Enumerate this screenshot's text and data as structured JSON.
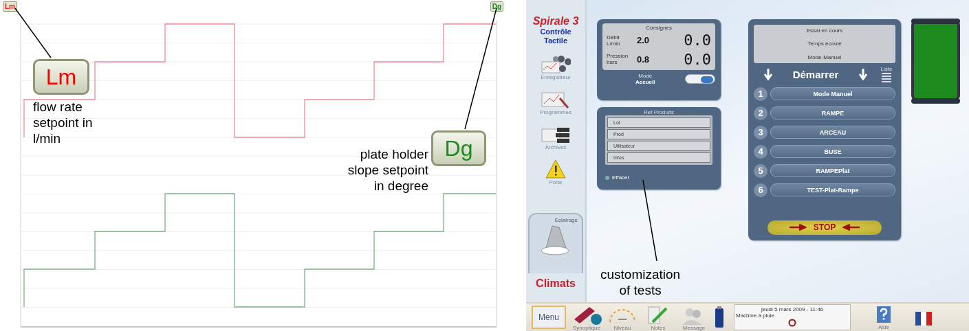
{
  "chart_panel": {
    "corner_tags": [
      {
        "text": "Lm",
        "color": "#e02020"
      },
      {
        "text": "Dg",
        "color": "#1a8a1a"
      }
    ],
    "annotations": [
      {
        "kind": "flow",
        "tag": "Lm",
        "color": "#ff0000",
        "lines": [
          "flow rate",
          "setpoint in",
          "l/min"
        ]
      },
      {
        "kind": "slope",
        "tag": "Dg",
        "color": "#1a8a1a",
        "lines": [
          "plate holder",
          "slope setpoint",
          "in degree"
        ]
      }
    ]
  },
  "app": {
    "brand": {
      "product": "Spirale",
      "version": "3",
      "subtitle": "Contrôle Tactile",
      "maker": "Climats"
    },
    "nav": [
      {
        "label": "Enregistreur",
        "kind": "recorder"
      },
      {
        "label": "Programmes",
        "kind": "programs"
      },
      {
        "label": "Archives",
        "kind": "archives"
      },
      {
        "label": "Porte",
        "kind": "warning"
      }
    ],
    "light": {
      "label": "Eclairage"
    },
    "setpoints": {
      "title": "Consignes",
      "rows": [
        {
          "label": "Débit L/min",
          "setpoint": "2.0",
          "reading": "0.0"
        },
        {
          "label": "Pression bars",
          "setpoint": "0.8",
          "reading": "0.0"
        }
      ],
      "mode_label": "Mode",
      "mode_value": "Accueil",
      "switch_on": true
    },
    "product_ref": {
      "title": "Ref Produits",
      "fields": [
        "Lot",
        "Prod",
        "Utilisateur",
        "Infos"
      ],
      "clear": "Effacer"
    },
    "annotation": {
      "lines": [
        "customization",
        "of tests"
      ]
    },
    "test_panel": {
      "status": [
        "Essai en cours",
        "Temps écoulé",
        "Mode-Manuel"
      ],
      "start": "Démarrer",
      "list_label": "Liste",
      "programs": [
        {
          "number": "1",
          "name": "Mode Manuel"
        },
        {
          "number": "2",
          "name": "RAMPE"
        },
        {
          "number": "3",
          "name": "ARCEAU"
        },
        {
          "number": "4",
          "name": "BUSE"
        },
        {
          "number": "5",
          "name": "RAMPEPlat"
        },
        {
          "number": "6",
          "name": "TEST-Plat-Rampe"
        }
      ],
      "stop": "STOP"
    },
    "toolbar": {
      "menu": "Menu",
      "items": [
        {
          "label": "Synoptique",
          "kind": "synoptic"
        },
        {
          "label": "Niveau",
          "kind": "level"
        },
        {
          "label": "Notes",
          "kind": "notes"
        },
        {
          "label": "Message",
          "kind": "message"
        }
      ],
      "date": "jeudi 5 mars 2009 - 11:46",
      "machine": "Machine à pluie",
      "help": "Aide"
    }
  }
}
